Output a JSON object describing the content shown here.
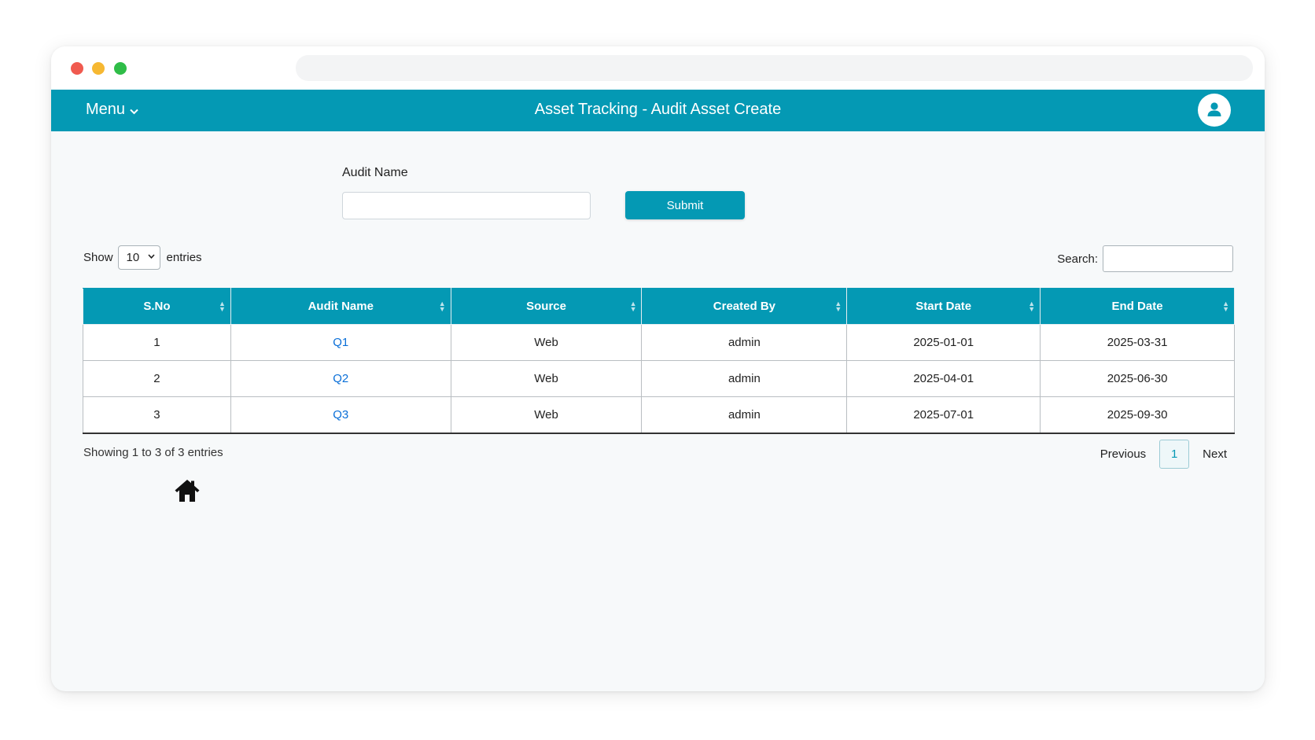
{
  "app": {
    "menu_label": "Menu",
    "title": "Asset Tracking - Audit Asset Create"
  },
  "form": {
    "audit_name_label": "Audit Name",
    "audit_name_value": "",
    "audit_name_placeholder": "",
    "submit_label": "Submit"
  },
  "table_controls": {
    "show_label": "Show",
    "entries_value": "10",
    "entries_label": "entries",
    "search_label": "Search:",
    "search_value": ""
  },
  "table": {
    "headers": [
      "S.No",
      "Audit Name",
      "Source",
      "Created By",
      "Start Date",
      "End Date"
    ],
    "rows": [
      [
        "1",
        "Q1",
        "Web",
        "admin",
        "2025-01-01",
        "2025-03-31"
      ],
      [
        "2",
        "Q2",
        "Web",
        "admin",
        "2025-04-01",
        "2025-06-30"
      ],
      [
        "3",
        "Q3",
        "Web",
        "admin",
        "2025-07-01",
        "2025-09-30"
      ]
    ]
  },
  "footer": {
    "info": "Showing 1 to 3 of 3 entries",
    "previous_label": "Previous",
    "current_page": "1",
    "next_label": "Next"
  },
  "colors": {
    "brand": "#0499b4",
    "link": "#0a6fd8"
  },
  "icons": {
    "menu": "chevron-down-icon",
    "profile": "user-icon",
    "sort": "sort-icon",
    "home": "home-icon"
  }
}
